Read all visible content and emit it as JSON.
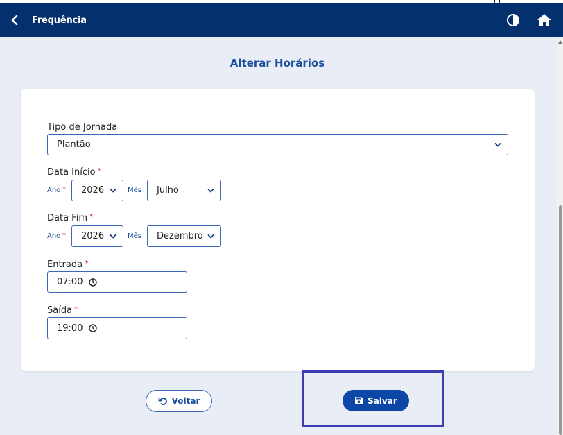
{
  "header": {
    "title": "Frequência",
    "back_icon": "chevron-left-icon",
    "contrast_icon": "contrast-icon",
    "home_icon": "home-icon"
  },
  "page": {
    "title": "Alterar Horários"
  },
  "form": {
    "tipo_jornada": {
      "label": "Tipo de Jornada",
      "value": "Plantão"
    },
    "data_inicio": {
      "label": "Data Início",
      "required_mark": "*",
      "ano_label": "Ano",
      "ano_value": "2026",
      "mes_label": "Mês",
      "mes_value": "Julho"
    },
    "data_fim": {
      "label": "Data Fim",
      "required_mark": "*",
      "ano_label": "Ano",
      "ano_value": "2026",
      "mes_label": "Mês",
      "mes_value": "Dezembro"
    },
    "entrada": {
      "label": "Entrada",
      "required_mark": "*",
      "value": "07:00"
    },
    "saida": {
      "label": "Saída",
      "required_mark": "*",
      "value": "19:00"
    }
  },
  "actions": {
    "voltar_label": "Voltar",
    "salvar_label": "Salvar"
  },
  "colors": {
    "header_bg": "#04306e",
    "accent": "#1b4e9c",
    "primary_button": "#0c46a6",
    "required": "#d0191f",
    "highlight_box": "#3f3bb3"
  }
}
